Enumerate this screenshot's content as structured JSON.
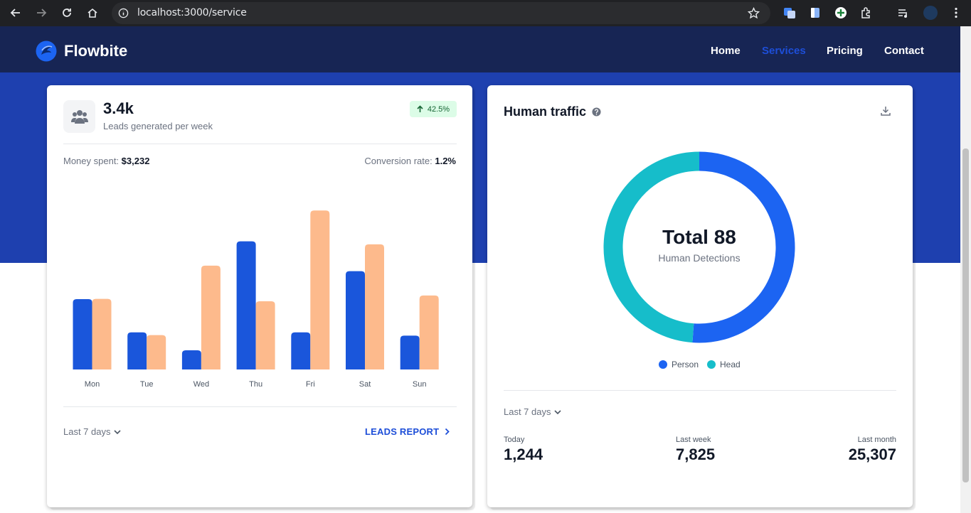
{
  "browser": {
    "url": "localhost:3000/service"
  },
  "navbar": {
    "brand": "Flowbite",
    "links": [
      {
        "label": "Home"
      },
      {
        "label": "Services"
      },
      {
        "label": "Pricing"
      },
      {
        "label": "Contact"
      }
    ]
  },
  "leads_card": {
    "value": "3.4k",
    "caption": "Leads generated per week",
    "badge": "42.5%",
    "money_label": "Money spent:",
    "money_value": "$3,232",
    "conversion_label": "Conversion rate:",
    "conversion_value": "1.2%",
    "dropdown": "Last 7 days",
    "report_link": "LEADS REPORT",
    "colors": {
      "series1": "#1a56db",
      "series2": "#fdba8c"
    }
  },
  "traffic_card": {
    "title": "Human traffic",
    "total": "Total 88",
    "subtitle": "Human Detections",
    "legend": [
      {
        "label": "Person",
        "color": "#1c64f2"
      },
      {
        "label": "Head",
        "color": "#16bdca"
      }
    ],
    "dropdown": "Last 7 days",
    "periods": [
      {
        "label": "Today",
        "value": "1,244"
      },
      {
        "label": "Last week",
        "value": "7,825"
      },
      {
        "label": "Last month",
        "value": "25,307"
      }
    ]
  },
  "chart_data": [
    {
      "type": "bar",
      "categories": [
        "Mon",
        "Tue",
        "Wed",
        "Thu",
        "Fri",
        "Sat",
        "Sun"
      ],
      "series": [
        {
          "values": [
            231,
            122,
            63,
            421,
            122,
            323,
            111
          ]
        },
        {
          "values": [
            232,
            113,
            341,
            224,
            522,
            411,
            243
          ]
        }
      ],
      "ylim": [
        0,
        560
      ],
      "grid": false
    },
    {
      "type": "pie",
      "donut": true,
      "labels": [
        "Person",
        "Head"
      ],
      "values": [
        45,
        43
      ],
      "total": 88
    }
  ]
}
